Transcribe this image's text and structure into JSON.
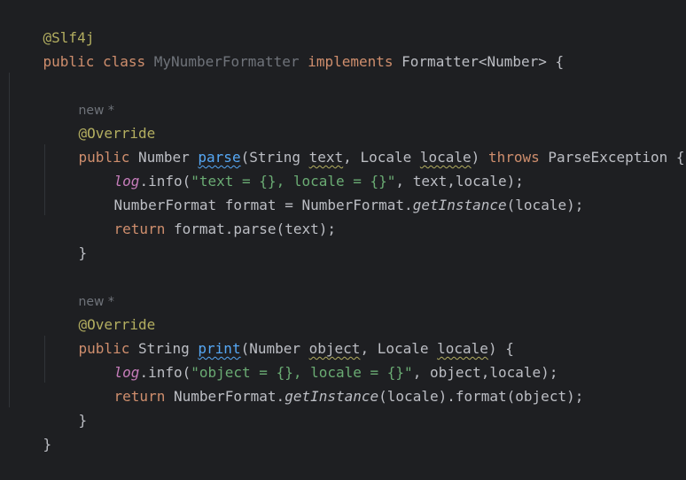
{
  "editor": {
    "lines": {
      "l1": {
        "annotation": "@Slf4j"
      },
      "l2": {
        "kw_public": "public",
        "kw_class": "class",
        "class_name": "MyNumberFormatter",
        "kw_implements": "implements",
        "iface": "Formatter<Number>",
        "brace": " {"
      },
      "l4": {
        "hint": "new *"
      },
      "l5": {
        "annotation": "@Override"
      },
      "l6": {
        "kw_public": "public",
        "ret": "Number",
        "method": "parse",
        "p_open": "(String ",
        "param1": "text",
        "sep": ", Locale ",
        "param2": "locale",
        "p_close": ")",
        "kw_throws": "throws",
        "exc": "ParseException {"
      },
      "l7": {
        "log": "log",
        "call": ".info(",
        "str": "\"text = {}, locale = {}\"",
        "rest": ", text,locale);"
      },
      "l8": {
        "pre": "NumberFormat format = NumberFormat.",
        "static": "getInstance",
        "post": "(locale);"
      },
      "l9": {
        "kw_return": "return",
        "rest": " format.parse(text);"
      },
      "l10": {
        "brace": "}"
      },
      "l12": {
        "hint": "new *"
      },
      "l13": {
        "annotation": "@Override"
      },
      "l14": {
        "kw_public": "public",
        "ret": "String",
        "method": "print",
        "p_open": "(Number ",
        "param1": "object",
        "sep": ", Locale ",
        "param2": "locale",
        "p_close": ") {"
      },
      "l15": {
        "log": "log",
        "call": ".info(",
        "str": "\"object = {}, locale = {}\"",
        "rest": ", object,locale);"
      },
      "l16": {
        "kw_return": "return",
        "pre": " NumberFormat.",
        "static": "getInstance",
        "post": "(locale).format(object);"
      },
      "l17": {
        "brace": "}"
      },
      "l18": {
        "brace": "}"
      }
    },
    "colors": {
      "background": "#1e1f22",
      "keyword": "#cf8e6d",
      "annotation": "#b3ae60",
      "string": "#6aab73",
      "field": "#c77dbb",
      "method_declaration": "#56a8f5",
      "default_text": "#bcbec4",
      "hint": "#6f737a"
    }
  }
}
